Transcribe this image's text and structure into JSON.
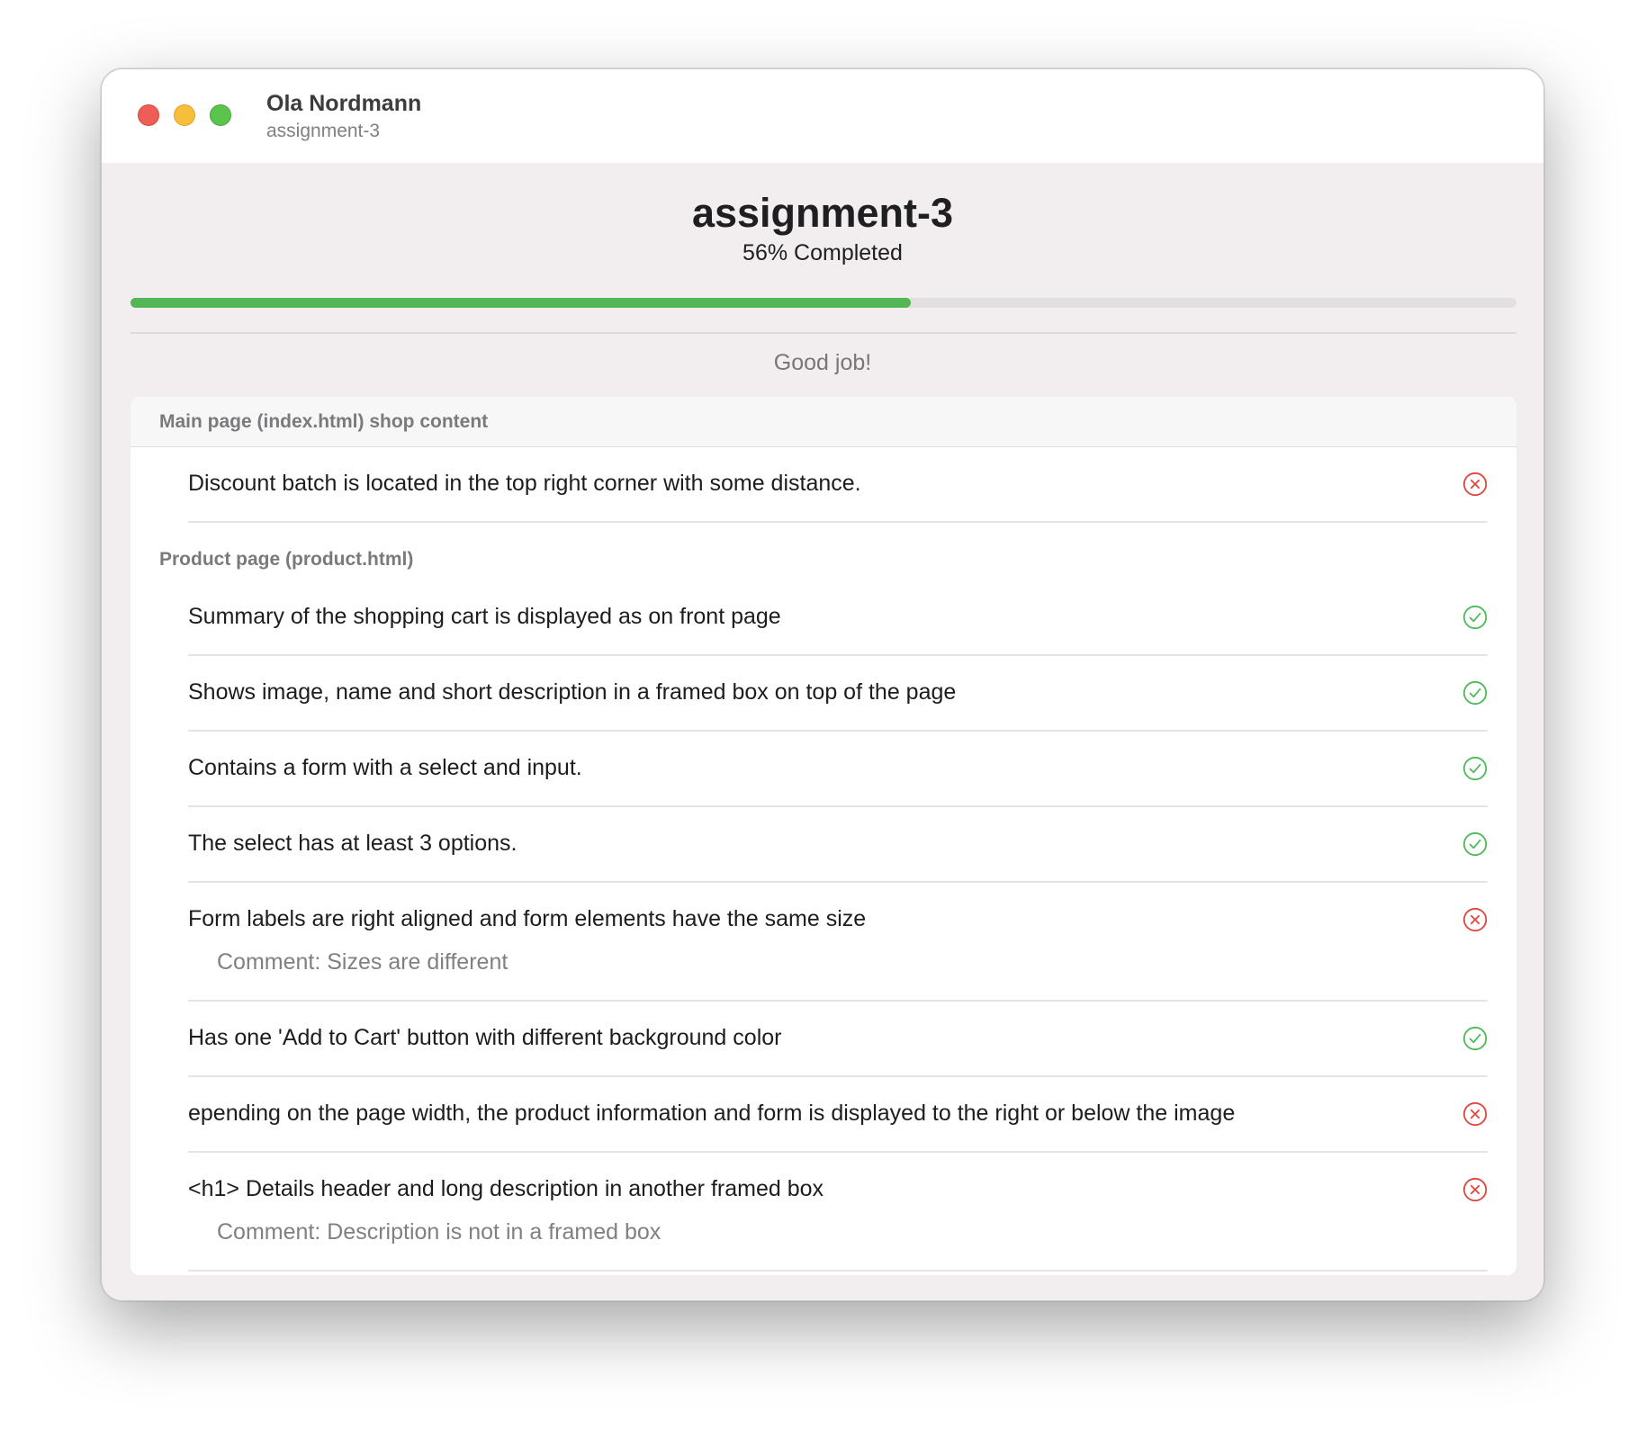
{
  "window": {
    "title": "Ola Nordmann",
    "subtitle": "assignment-3"
  },
  "header": {
    "title": "assignment-3",
    "progress_text": "56% Completed",
    "progress_fraction": 0.563,
    "message": "Good job!"
  },
  "colors": {
    "pass": "#4cbb57",
    "fail": "#e0453d",
    "progress": "#52b655"
  },
  "sections": [
    {
      "title": "Main page (index.html) shop content",
      "items": [
        {
          "text": "Discount batch is located in the top right corner with some distance.",
          "status": "fail",
          "icon": "x-circle-icon"
        }
      ]
    },
    {
      "title": "Product page (product.html)",
      "items": [
        {
          "text": "Summary of the shopping cart is displayed as on front page",
          "status": "pass",
          "icon": "check-circle-icon"
        },
        {
          "text": "Shows image, name and short description in a framed box on top of the page",
          "status": "pass",
          "icon": "check-circle-icon"
        },
        {
          "text": "Contains a form with a select and input.",
          "status": "pass",
          "icon": "check-circle-icon"
        },
        {
          "text": "The select has at least 3 options.",
          "status": "pass",
          "icon": "check-circle-icon"
        },
        {
          "text": "Form labels are right aligned and form elements have the same size",
          "status": "fail",
          "icon": "x-circle-icon",
          "comment": "Comment: Sizes are different"
        },
        {
          "text": "Has one 'Add to Cart' button with different background color",
          "status": "pass",
          "icon": "check-circle-icon"
        },
        {
          "text": "epending on the page width, the product information and form is displayed to the right or below the image",
          "status": "fail",
          "icon": "x-circle-icon"
        },
        {
          "text": "<h1> Details header and long description in another framed box",
          "status": "fail",
          "icon": "x-circle-icon",
          "comment": "Comment: Description is not in a framed box"
        }
      ]
    }
  ]
}
